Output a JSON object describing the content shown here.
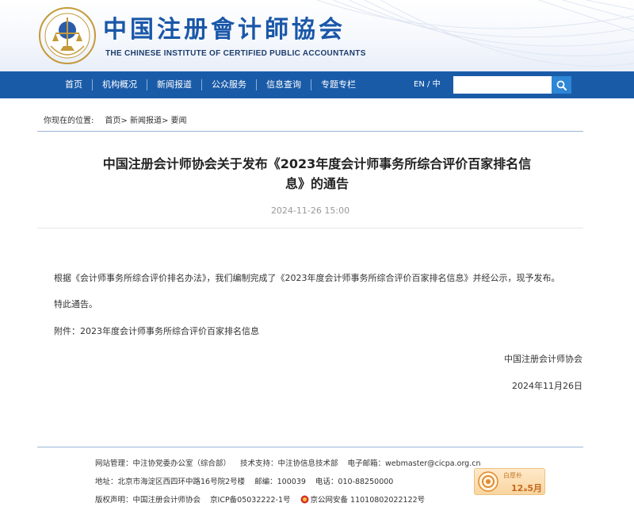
{
  "header": {
    "title_cn": "中国注册會计師協会",
    "title_en": "THE CHINESE INSTITUTE OF CERTIFIED PUBLIC ACCOUNTANTS"
  },
  "nav": {
    "items": [
      {
        "label": "首页"
      },
      {
        "label": "机构概况"
      },
      {
        "label": "新闻报道"
      },
      {
        "label": "公众服务"
      },
      {
        "label": "信息查询"
      },
      {
        "label": "专题专栏"
      }
    ],
    "lang_en": "EN",
    "lang_sep": "/",
    "lang_cn": "中",
    "search_value": ""
  },
  "breadcrumb": {
    "label": "你现在的位置:",
    "home": "首页>",
    "news": "新闻报道>",
    "current": "要闻"
  },
  "article": {
    "title": "中国注册会计师协会关于发布《2023年度会计师事务所综合评价百家排名信息》的通告",
    "date": "2024-11-26 15:00",
    "para_1": "根据《会计师事务所综合评价排名办法》，我们编制完成了《2023年度会计师事务所综合评价百家排名信息》并经公示，现予发布。",
    "para_2": "特此通告。",
    "attachment": "附件：2023年度会计师事务所综合评价百家排名信息",
    "signer": "中国注册会计师协会",
    "sign_date": "2024年11月26日"
  },
  "footer": {
    "site_admin": "网站管理：中注协党委办公室（综合部）",
    "tech_support": "技术支持：中注协信息技术部",
    "email": "电子邮箱：webmaster@cicpa.org.cn",
    "address": "地址：北京市海淀区西四环中路16号院2号楼",
    "postcode": "邮编：100039",
    "phone": "电话：010-88250000",
    "copyright": "版权声明：中国注册会计师协会",
    "icp": "京ICP备05032222-1号",
    "police": "京公网安备 11010802022122号",
    "badge_line1": "白厚朴",
    "badge_line2": "12ₐ5月"
  },
  "colors": {
    "brand_blue": "#1a5ba8",
    "title_blue": "#1a57a8",
    "search_button": "#2d86d6"
  }
}
